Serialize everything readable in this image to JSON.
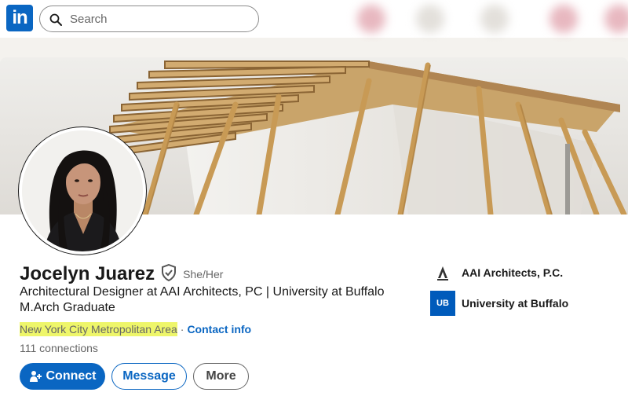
{
  "nav": {
    "logo_text": "in",
    "search_placeholder": "Search"
  },
  "profile": {
    "name": "Jocelyn Juarez",
    "pronouns": "She/Her",
    "headline": "Architectural Designer at AAI Architects, PC | University at Buffalo M.Arch Graduate",
    "location": "New York City Metropolitan Area",
    "separator": "·",
    "contact_info_label": "Contact info",
    "connections": "111 connections"
  },
  "actions": {
    "connect_label": "Connect",
    "message_label": "Message",
    "more_label": "More"
  },
  "organizations": [
    {
      "name": "AAI Architects, P.C.",
      "logo_text": ""
    },
    {
      "name": "University at Buffalo",
      "logo_text": "UB"
    }
  ],
  "colors": {
    "brand_blue": "#0a66c2",
    "location_highlight": "#eef66a",
    "ub_blue": "#005bbb"
  }
}
